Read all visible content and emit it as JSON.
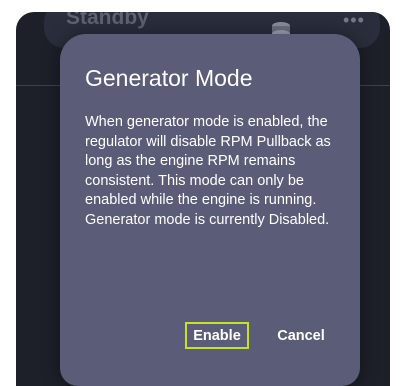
{
  "background": {
    "status_label": "Standby",
    "engine_icon": "engine-icon",
    "more_icon": "more-icon"
  },
  "dialog": {
    "title": "Generator Mode",
    "body": "When generator mode is enabled, the regulator will disable RPM Pullback as long as the engine RPM remains consistent. This mode can only be enabled while the engine is running.\n Generator mode is currently Disabled.",
    "enable_label": "Enable",
    "cancel_label": "Cancel"
  },
  "colors": {
    "dialog_bg": "#5a5c78",
    "app_bg": "#1d1f29",
    "focus_outline": "#c6e12a",
    "accent_line": "#7a2a2f"
  }
}
